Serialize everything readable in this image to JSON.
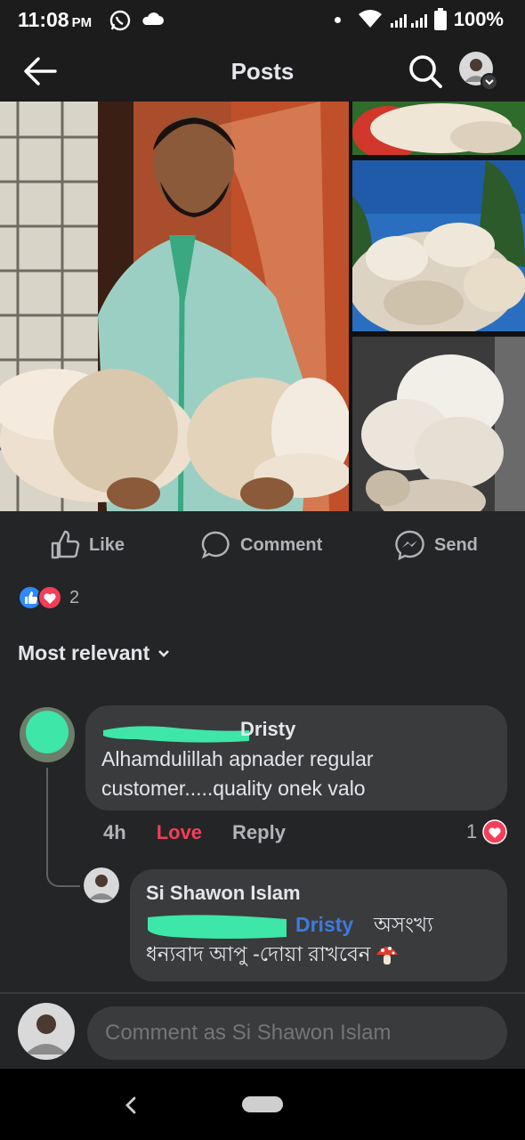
{
  "status": {
    "time": "11:08",
    "ampm": "PM",
    "battery": "100%"
  },
  "appbar": {
    "title": "Posts"
  },
  "actions": {
    "like": "Like",
    "comment": "Comment",
    "send": "Send"
  },
  "reactions": {
    "count": "2"
  },
  "sort": {
    "label": "Most relevant"
  },
  "comments": [
    {
      "author": "Dristy",
      "text_line1": "Alhamdulillah apnader regular",
      "text_line2": "customer.....quality onek valo",
      "time": "4h",
      "reaction_label": "Love",
      "reply_label": "Reply",
      "reaction_count": "1"
    }
  ],
  "reply": {
    "author": "Si Shawon Islam",
    "mention": "Dristy",
    "text_line1": "অসংখ্য",
    "text_line2": "ধন্যবাদ আপু -দোয়া রাখবেন"
  },
  "composer": {
    "placeholder": "Comment as Si Shawon Islam"
  },
  "colors": {
    "background": "#242526",
    "bubble": "#3a3b3c",
    "love": "#f33e58",
    "link": "#3c7be0",
    "highlighter": "#3ee6a8"
  }
}
